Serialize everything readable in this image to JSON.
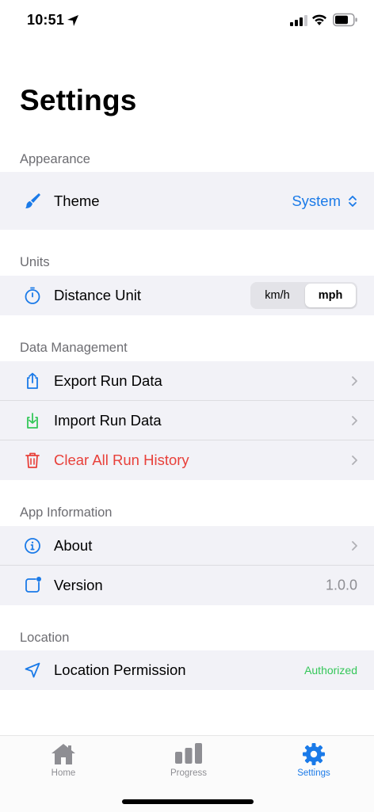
{
  "status": {
    "time": "10:51"
  },
  "page": {
    "title": "Settings"
  },
  "appearance": {
    "header": "Appearance",
    "theme_label": "Theme",
    "theme_value": "System"
  },
  "units": {
    "header": "Units",
    "distance_label": "Distance Unit",
    "options": [
      "km/h",
      "mph"
    ],
    "selected": "mph"
  },
  "data_management": {
    "header": "Data Management",
    "export_label": "Export Run Data",
    "import_label": "Import Run Data",
    "clear_label": "Clear All Run History"
  },
  "app_info": {
    "header": "App Information",
    "about_label": "About",
    "version_label": "Version",
    "version_value": "1.0.0"
  },
  "location": {
    "header": "Location",
    "permission_label": "Location Permission",
    "permission_value": "Authorized"
  },
  "tabs": [
    {
      "label": "Home",
      "icon": "house-icon"
    },
    {
      "label": "Progress",
      "icon": "bar-chart-icon"
    },
    {
      "label": "Settings",
      "icon": "gear-icon"
    }
  ],
  "colors": {
    "accent": "#1a7ae8",
    "destructive": "#e8403a",
    "success": "#34c759",
    "group_bg": "#f2f2f7",
    "secondary_text": "#8e8e93"
  }
}
